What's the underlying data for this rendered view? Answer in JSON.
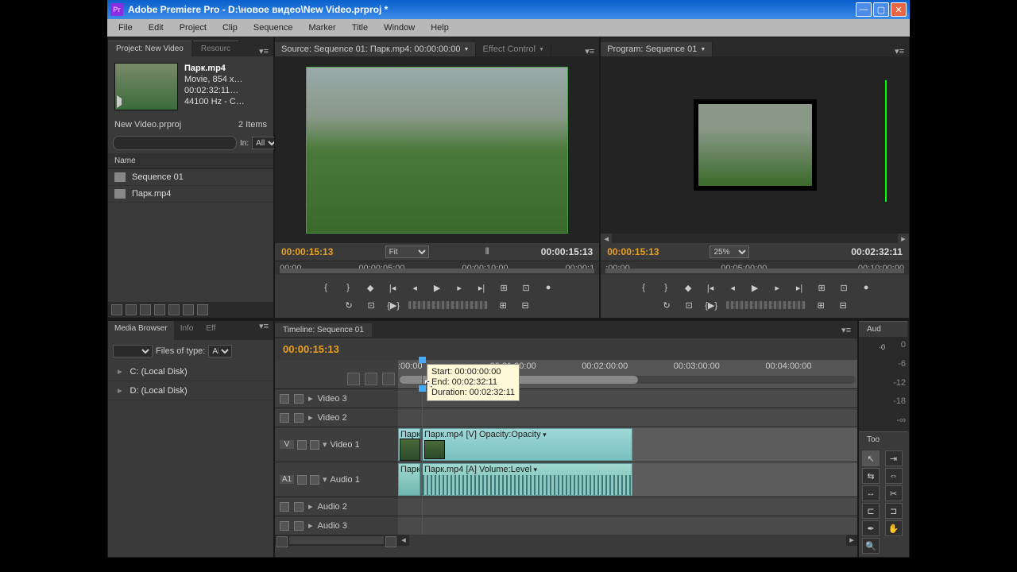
{
  "window": {
    "title": "Adobe Premiere Pro - D:\\новое видео\\New Video.prproj *",
    "app_abbr": "Pr"
  },
  "menu": [
    "File",
    "Edit",
    "Project",
    "Clip",
    "Sequence",
    "Marker",
    "Title",
    "Window",
    "Help"
  ],
  "project": {
    "tab_label": "Project: New Video",
    "tab2_label": "Resourc",
    "clip_name": "Парк.mp4",
    "clip_type": "Movie, 854 x…",
    "clip_dur": "00:02:32:11…",
    "clip_audio": "44100 Hz - C…",
    "bin_name": "New Video.prproj",
    "item_count": "2 Items",
    "search_placeholder": "",
    "in_label": "In:",
    "in_value": "All",
    "col_name": "Name",
    "items": [
      {
        "icon": "sequence",
        "label": "Sequence 01"
      },
      {
        "icon": "video-file",
        "label": "Парк.mp4"
      }
    ]
  },
  "source": {
    "tab": "Source: Sequence 01: Парк.mp4: 00:00:00:00",
    "tab2": "Effect Control",
    "tc_in": "00:00:15:13",
    "fit": "Fit",
    "tc_out": "00:00:15:13",
    "ruler": [
      "00:00",
      "00:00:05:00",
      "00:00:10:00",
      "00:00:1"
    ]
  },
  "program": {
    "tab": "Program: Sequence 01",
    "tc_in": "00:00:15:13",
    "zoom": "25%",
    "tc_out": "00:02:32:11",
    "ruler": [
      ":00:00",
      "00:05:00:00",
      "00:10:00:00"
    ]
  },
  "media_browser": {
    "tabs": [
      "Media Browser",
      "Info",
      "Eff"
    ],
    "files_type_label": "Files of type:",
    "files_type_value": "Al",
    "drives": [
      "C: (Local Disk)",
      "D: (Local Disk)"
    ]
  },
  "timeline": {
    "tab": "Timeline: Sequence 01",
    "tc": "00:00:15:13",
    "ruler": [
      ":00:00",
      "00:01:00:00",
      "00:02:00:00",
      "00:03:00:00",
      "00:04:00:00"
    ],
    "tracks": {
      "v3": "Video 3",
      "v2": "Video 2",
      "v1": "Video 1",
      "v1_patch": "V",
      "a1": "Audio 1",
      "a1_patch": "A1",
      "a2": "Audio 2",
      "a3": "Audio 3"
    },
    "clip_v_prefix": "Парк",
    "clip_v": "Парк.mp4 [V] Opacity:Opacity",
    "clip_a_prefix": "Парк",
    "clip_a": "Парк.mp4 [A] Volume:Level",
    "tooltip": {
      "start": "Start: 00:00:00:00",
      "end": "End: 00:02:32:11",
      "dur": "Duration: 00:02:32:11"
    }
  },
  "audio_panel": {
    "tab": "Aud",
    "scale": [
      "0",
      "-6",
      "-12",
      "-18",
      "-∞"
    ],
    "readout": "·0"
  },
  "tools_panel": {
    "tab": "Too"
  }
}
